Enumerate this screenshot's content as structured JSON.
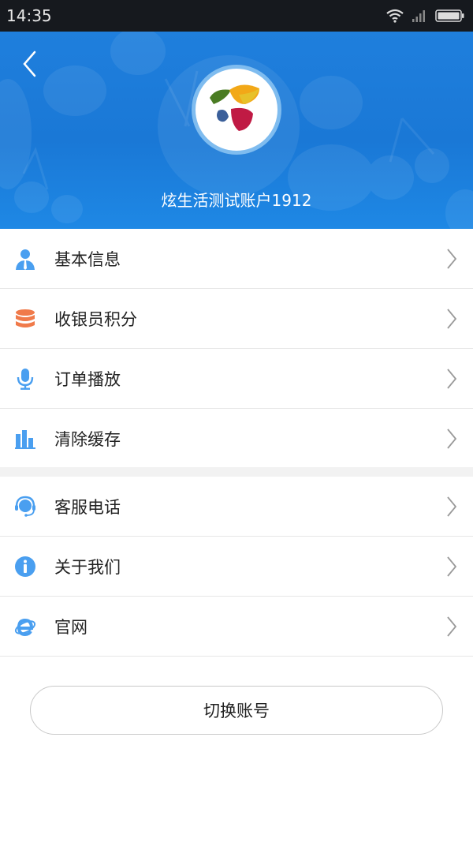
{
  "status_bar": {
    "time": "14:35"
  },
  "profile": {
    "account_name": "炫生活测试账户1912"
  },
  "menu_group_1": [
    {
      "label": "基本信息",
      "icon": "user-icon",
      "color": "#4a9ff0"
    },
    {
      "label": "收银员积分",
      "icon": "database-icon",
      "color": "#f07a4a"
    },
    {
      "label": "订单播放",
      "icon": "microphone-icon",
      "color": "#4a9ff0"
    },
    {
      "label": "清除缓存",
      "icon": "bar-chart-icon",
      "color": "#4a9ff0"
    }
  ],
  "menu_group_2": [
    {
      "label": "客服电话",
      "icon": "headset-icon",
      "color": "#4a9ff0"
    },
    {
      "label": "关于我们",
      "icon": "info-icon",
      "color": "#4a9ff0"
    },
    {
      "label": "官网",
      "icon": "browser-e-icon",
      "color": "#4a9ff0"
    }
  ],
  "switch_account_label": "切换账号",
  "colors": {
    "header_blue": "#1f7fdd",
    "icon_blue": "#4a9ff0",
    "icon_orange": "#f07a4a"
  }
}
